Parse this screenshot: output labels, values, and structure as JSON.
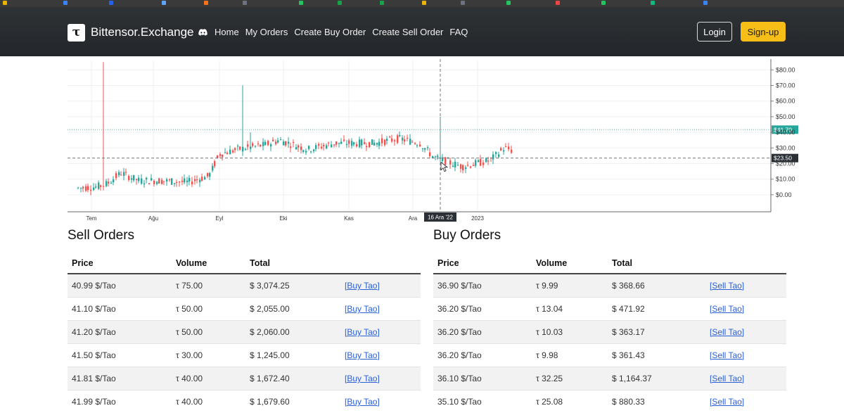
{
  "brand": {
    "name": "Bittensor.Exchange",
    "logo_glyph": "τ"
  },
  "nav": {
    "links": [
      "Home",
      "My Orders",
      "Create Buy Order",
      "Create Sell Order",
      "FAQ"
    ],
    "login_label": "Login",
    "signup_label": "Sign-up"
  },
  "colors": {
    "up": "#26a69a",
    "down": "#ef5350",
    "accent": "#f6be16",
    "price_tag": "#26a69a",
    "crosshair_tag": "#2b2f36"
  },
  "chart_data": {
    "type": "candlestick",
    "x_ticks": [
      "Tem",
      "Ağu",
      "Eyl",
      "Eki",
      "Kas",
      "Ara",
      "2023"
    ],
    "y_ticks": [
      "$80.00",
      "$70.00",
      "$60.00",
      "$50.00",
      "$40.00",
      "$30.00",
      "$20.00",
      "$10.00",
      "$0.00"
    ],
    "y_tick_values": [
      80,
      70,
      60,
      50,
      40,
      30,
      20,
      10,
      0
    ],
    "ylim": [
      -10,
      86
    ],
    "last_price_label": "$41.70",
    "last_price_value": 41.7,
    "crosshair_price_label": "$23.50",
    "crosshair_price_value": 23.5,
    "crosshair_date_label": "16 Ara '22",
    "grid": true
  },
  "sell_orders": {
    "title": "Sell Orders",
    "headers": [
      "Price",
      "Volume",
      "Total"
    ],
    "rows": [
      {
        "price": "40.99 $/Tao",
        "volume": "τ 75.00",
        "total": "$ 3,074.25",
        "action": "[Buy Tao]"
      },
      {
        "price": "41.10 $/Tao",
        "volume": "τ 50.00",
        "total": "$ 2,055.00",
        "action": "[Buy Tao]"
      },
      {
        "price": "41.20 $/Tao",
        "volume": "τ 50.00",
        "total": "$ 2,060.00",
        "action": "[Buy Tao]"
      },
      {
        "price": "41.50 $/Tao",
        "volume": "τ 30.00",
        "total": "$ 1,245.00",
        "action": "[Buy Tao]"
      },
      {
        "price": "41.81 $/Tao",
        "volume": "τ 40.00",
        "total": "$ 1,672.40",
        "action": "[Buy Tao]"
      },
      {
        "price": "41.99 $/Tao",
        "volume": "τ 40.00",
        "total": "$ 1,679.60",
        "action": "[Buy Tao]"
      }
    ]
  },
  "buy_orders": {
    "title": "Buy Orders",
    "headers": [
      "Price",
      "Volume",
      "Total"
    ],
    "rows": [
      {
        "price": "36.90 $/Tao",
        "volume": "τ 9.99",
        "total": "$ 368.66",
        "action": "[Sell Tao]"
      },
      {
        "price": "36.20 $/Tao",
        "volume": "τ 13.04",
        "total": "$ 471.92",
        "action": "[Sell Tao]"
      },
      {
        "price": "36.20 $/Tao",
        "volume": "τ 10.03",
        "total": "$ 363.17",
        "action": "[Sell Tao]"
      },
      {
        "price": "36.20 $/Tao",
        "volume": "τ 9.98",
        "total": "$ 361.43",
        "action": "[Sell Tao]"
      },
      {
        "price": "36.10 $/Tao",
        "volume": "τ 32.25",
        "total": "$ 1,164.37",
        "action": "[Sell Tao]"
      },
      {
        "price": "35.10 $/Tao",
        "volume": "τ 25.08",
        "total": "$ 880.33",
        "action": "[Sell Tao]"
      }
    ]
  }
}
